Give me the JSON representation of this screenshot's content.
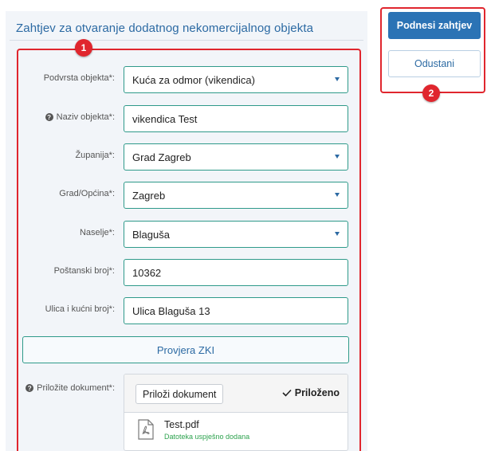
{
  "form": {
    "title": "Zahtjev za otvaranje dodatnog nekomercijalnog objekta",
    "fields": [
      {
        "label": "Podvrsta objekta*:",
        "value": "Kuća za odmor (vikendica)",
        "type": "select",
        "info": false
      },
      {
        "label": "Naziv objekta*:",
        "value": "vikendica Test",
        "type": "text",
        "info": true
      },
      {
        "label": "Županija*:",
        "value": "Grad Zagreb",
        "type": "select",
        "info": false
      },
      {
        "label": "Grad/Općina*:",
        "value": "Zagreb",
        "type": "select",
        "info": false
      },
      {
        "label": "Naselje*:",
        "value": "Blaguša",
        "type": "select",
        "info": false
      },
      {
        "label": "Poštanski broj*:",
        "value": "10362",
        "type": "text",
        "info": false
      },
      {
        "label": "Ulica i kućni broj*:",
        "value": "Ulica Blaguša 13",
        "type": "text",
        "info": false
      }
    ],
    "zki_button": "Provjera ZKI",
    "attachment": {
      "label": "Priložite dokument*:",
      "button": "Priloži dokument",
      "status": "Priloženo",
      "file_name": "Test.pdf",
      "file_status": "Datoteka uspješno dodana"
    }
  },
  "actions": {
    "submit": "Podnesi zahtjev",
    "cancel": "Odustani"
  },
  "annotations": {
    "badge_1": "1",
    "badge_2": "2"
  },
  "colors": {
    "accent": "#2b73b5",
    "field_border": "#2f9a8a",
    "highlight": "#e0262e",
    "success": "#2ea34f"
  },
  "icons": {
    "select": "caret-down-icon",
    "info": "info-circle-icon",
    "attached": "checkmark-icon",
    "file": "pdf-file-icon"
  }
}
